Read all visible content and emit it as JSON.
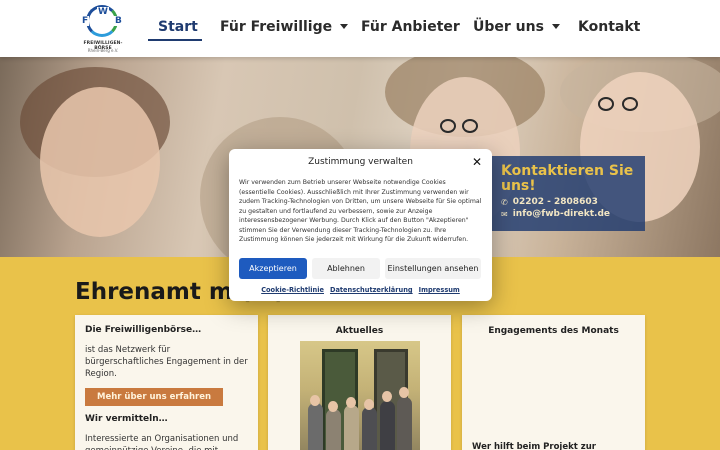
{
  "header": {
    "logo": {
      "letters": [
        "F",
        "W",
        "B"
      ],
      "name": "FREIWILLIGEN-BÖRSE",
      "sub": "Rhein-Berg e.V."
    },
    "nav": [
      {
        "label": "Start",
        "active": true,
        "dropdown": false
      },
      {
        "label": "Für Freiwillige",
        "active": false,
        "dropdown": true
      },
      {
        "label": "Für Anbieter",
        "active": false,
        "dropdown": false
      },
      {
        "label": "Über uns",
        "active": false,
        "dropdown": true
      },
      {
        "label": "Kontakt",
        "active": false,
        "dropdown": false
      }
    ]
  },
  "contact": {
    "title": "Kontaktieren Sie uns!",
    "phone": "02202 - 2808603",
    "email": "info@fwb-direkt.de",
    "phone_icon": "phone-icon",
    "email_icon": "envelope-icon"
  },
  "main": {
    "section_title": "Ehrenamt m",
    "section_title_hidden_tail": "(…)",
    "card1": {
      "heading": "Die Freiwilligenbörse…",
      "text": "ist das Netzwerk für bürgerschaftliches Engagement in der Region.",
      "button": "Mehr über uns erfahren",
      "heading2": "Wir vermitteln…",
      "text2": "Interessierte an Organisationen und gemeinnützige Vereine, die mit Ehrenamtlichen arbeiten möchten."
    },
    "card2": {
      "title": "Aktuelles"
    },
    "card3": {
      "title": "Engagements des Monats",
      "footer": "Wer hilft beim Projekt zur"
    }
  },
  "consent": {
    "title": "Zustimmung verwalten",
    "close_icon": "close-icon",
    "text": "Wir verwenden zum Betrieb unserer Webseite notwendige Cookies (essentielle Cookies). Ausschließlich mit Ihrer Zustimmung verwenden wir zudem Tracking-Technologien von Dritten, um unsere Webseite für Sie optimal zu gestalten und fortlaufend zu verbessern, sowie zur Anzeige interessensbezogener Werbung. Durch Klick auf den Button \"Akzeptieren\" stimmen Sie der Verwendung dieser Tracking-Technologien zu. Ihre Zustimmung können Sie jederzeit mit Wirkung für die Zukunft widerrufen.",
    "accept": "Akzeptieren",
    "deny": "Ablehnen",
    "settings": "Einstellungen ansehen",
    "links": [
      "Cookie-Richtlinie",
      "Datenschutzerklärung",
      "Impressum"
    ]
  },
  "colors": {
    "brand_blue": "#1f3b70",
    "accent_yellow": "#e9c24a",
    "button_orange": "#c97a3f",
    "accept_blue": "#1e5bbf"
  }
}
